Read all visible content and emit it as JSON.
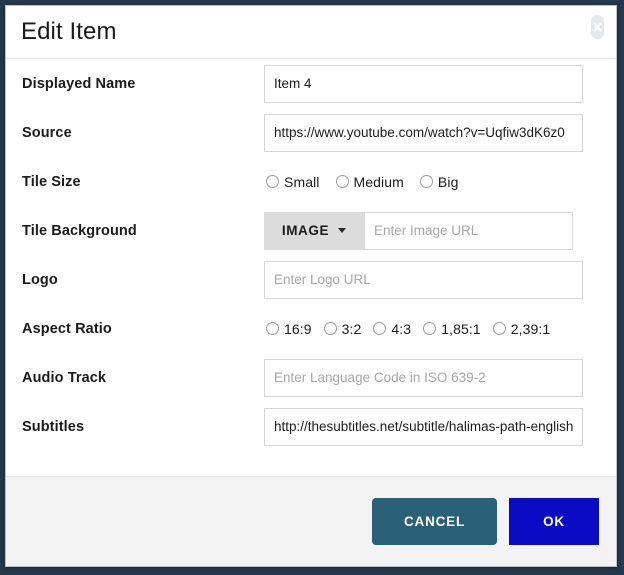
{
  "dialog": {
    "title": "Edit Item",
    "close_icon": "close-icon"
  },
  "form": {
    "displayed_name": {
      "label": "Displayed Name",
      "value": "Item 4",
      "placeholder": ""
    },
    "source": {
      "label": "Source",
      "value": "https://www.youtube.com/watch?v=Uqfiw3dK6z0",
      "placeholder": ""
    },
    "tile_size": {
      "label": "Tile Size",
      "options": [
        "Small",
        "Medium",
        "Big"
      ],
      "selected": ""
    },
    "tile_background": {
      "label": "Tile Background",
      "dropdown_value": "IMAGE",
      "dropdown_icon": "chevron-down-icon",
      "value": "",
      "placeholder": "Enter Image URL"
    },
    "logo": {
      "label": "Logo",
      "value": "",
      "placeholder": "Enter Logo URL"
    },
    "aspect_ratio": {
      "label": "Aspect Ratio",
      "options": [
        "16:9",
        "3:2",
        "4:3",
        "1,85:1",
        "2,39:1"
      ],
      "selected": ""
    },
    "audio_track": {
      "label": "Audio Track",
      "value": "",
      "placeholder": "Enter Language Code in ISO 639-2"
    },
    "subtitles": {
      "label": "Subtitles",
      "value": "http://thesubtitles.net/subtitle/halimas-path-english",
      "placeholder": ""
    }
  },
  "footer": {
    "cancel_label": "CANCEL",
    "ok_label": "OK"
  },
  "colors": {
    "cancel_button": "#2b6079",
    "ok_button": "#0b0bc4",
    "backdrop": "#25384c",
    "dropdown_bg": "#dcdcdc",
    "footer_bg": "#f3f3f3"
  }
}
